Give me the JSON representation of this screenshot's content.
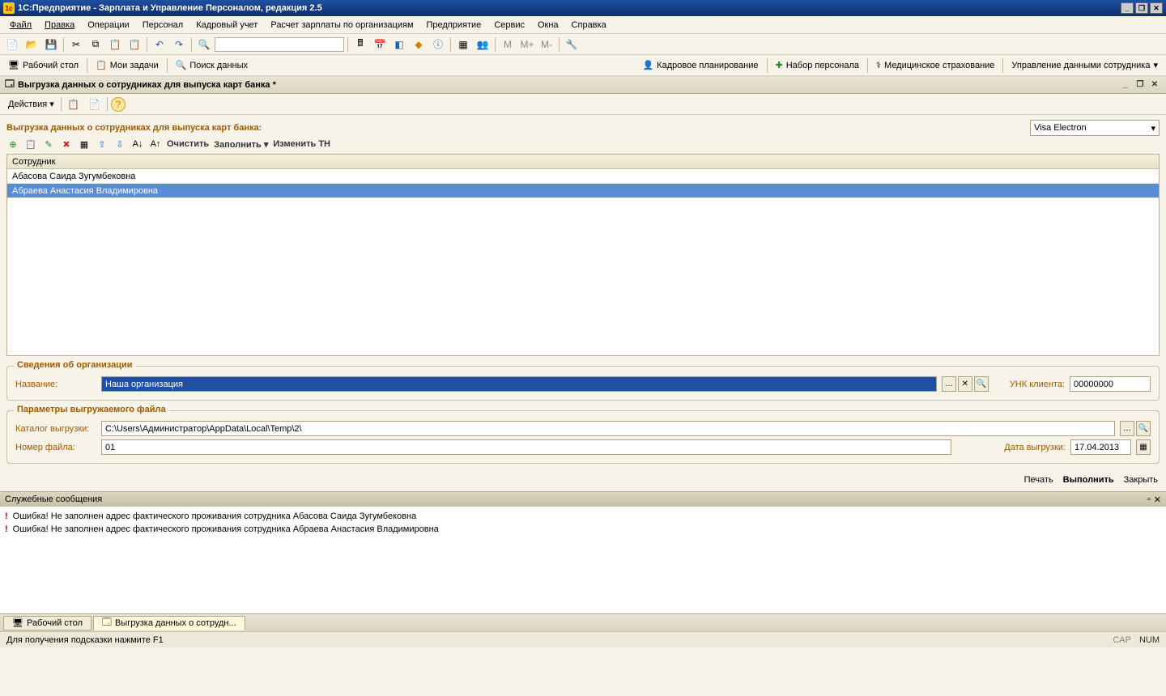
{
  "title": "1С:Предприятие - Зарплата и Управление Персоналом, редакция 2.5",
  "menu": [
    "Файл",
    "Правка",
    "Операции",
    "Персонал",
    "Кадровый учет",
    "Расчет зарплаты по организациям",
    "Предприятие",
    "Сервис",
    "Окна",
    "Справка"
  ],
  "nav": {
    "desktop": "Рабочий стол",
    "tasks": "Мои задачи",
    "search": "Поиск данных",
    "right": [
      "Кадровое планирование",
      "Набор персонала",
      "Медицинское страхование",
      "Управление данными сотрудника"
    ]
  },
  "doc": {
    "title": "Выгрузка данных о сотрудниках для выпуска карт банка *"
  },
  "actions": {
    "label": "Действия"
  },
  "form": {
    "title": "Выгрузка данных о сотрудниках для выпуска карт банка:",
    "card_type": "Visa Electron",
    "clear": "Очистить",
    "fill": "Заполнить",
    "changetn": "Изменить ТН",
    "col": "Сотрудник",
    "rows": [
      "Абасова Саида Зугумбековна",
      "Абраева Анастасия Владимировна"
    ]
  },
  "org": {
    "legend": "Сведения об организации",
    "name_label": "Название:",
    "name_value": "Наша организация",
    "unk_label": "УНК клиента:",
    "unk_value": "00000000"
  },
  "file": {
    "legend": "Параметры выгружаемого файла",
    "dir_label": "Каталог выгрузки:",
    "dir_value": "C:\\Users\\Администратор\\AppData\\Local\\Temp\\2\\",
    "num_label": "Номер файла:",
    "num_value": "01",
    "date_label": "Дата выгрузки:",
    "date_value": "17.04.2013"
  },
  "footer": {
    "print": "Печать",
    "run": "Выполнить",
    "close": "Закрыть"
  },
  "messages": {
    "title": "Служебные сообщения",
    "lines": [
      "Ошибка! Не заполнен адрес фактического проживания сотрудника Абасова Саида Зугумбековна",
      "Ошибка! Не заполнен адрес фактического проживания сотрудника Абраева Анастасия Владимировна"
    ]
  },
  "taskbar": {
    "tab1": "Рабочий стол",
    "tab2": "Выгрузка данных о сотрудн..."
  },
  "status": {
    "hint": "Для получения подсказки нажмите F1",
    "cap": "CAP",
    "num": "NUM"
  }
}
